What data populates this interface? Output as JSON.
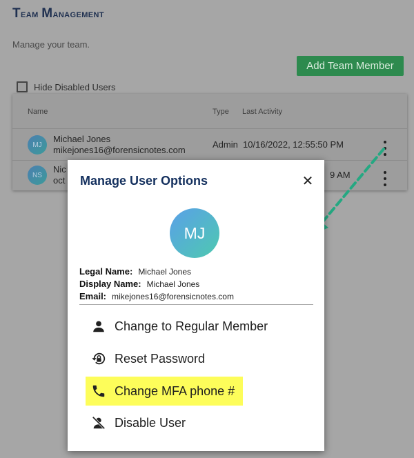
{
  "page": {
    "title_first": "T",
    "title_first_rest": "eam ",
    "title_second": "M",
    "title_second_rest": "anagement",
    "subtitle": "Manage your team.",
    "add_button": "Add Team Member",
    "hide_disabled_label": "Hide Disabled Users"
  },
  "table": {
    "headers": {
      "name": "Name",
      "type": "Type",
      "last_activity": "Last Activity"
    },
    "rows": [
      {
        "initials": "MJ",
        "name": "Michael Jones",
        "email": "mikejones16@forensicnotes.com",
        "type": "Admin",
        "last_activity": "10/16/2022, 12:55:50 PM"
      },
      {
        "initials": "NS",
        "name": "Nic",
        "email": "oct",
        "type": "",
        "last_activity": "9 AM"
      }
    ]
  },
  "modal": {
    "title": "Manage User Options",
    "close_glyph": "✕",
    "avatar_initials": "MJ",
    "legal_name_label": "Legal Name:",
    "legal_name": "Michael Jones",
    "display_name_label": "Display Name:",
    "display_name": "Michael Jones",
    "email_label": "Email:",
    "email": "mikejones16@forensicnotes.com",
    "options": [
      {
        "label": "Change to Regular Member",
        "icon": "person-icon"
      },
      {
        "label": "Reset Password",
        "icon": "lock-reset-icon"
      },
      {
        "label": "Change MFA phone #",
        "icon": "phone-icon"
      },
      {
        "label": "Disable User",
        "icon": "person-off-icon"
      }
    ]
  },
  "colors": {
    "accent": "#2d8a4e",
    "title": "#14305e",
    "highlight": "#fdfd5a",
    "arrow": "#25a882"
  }
}
